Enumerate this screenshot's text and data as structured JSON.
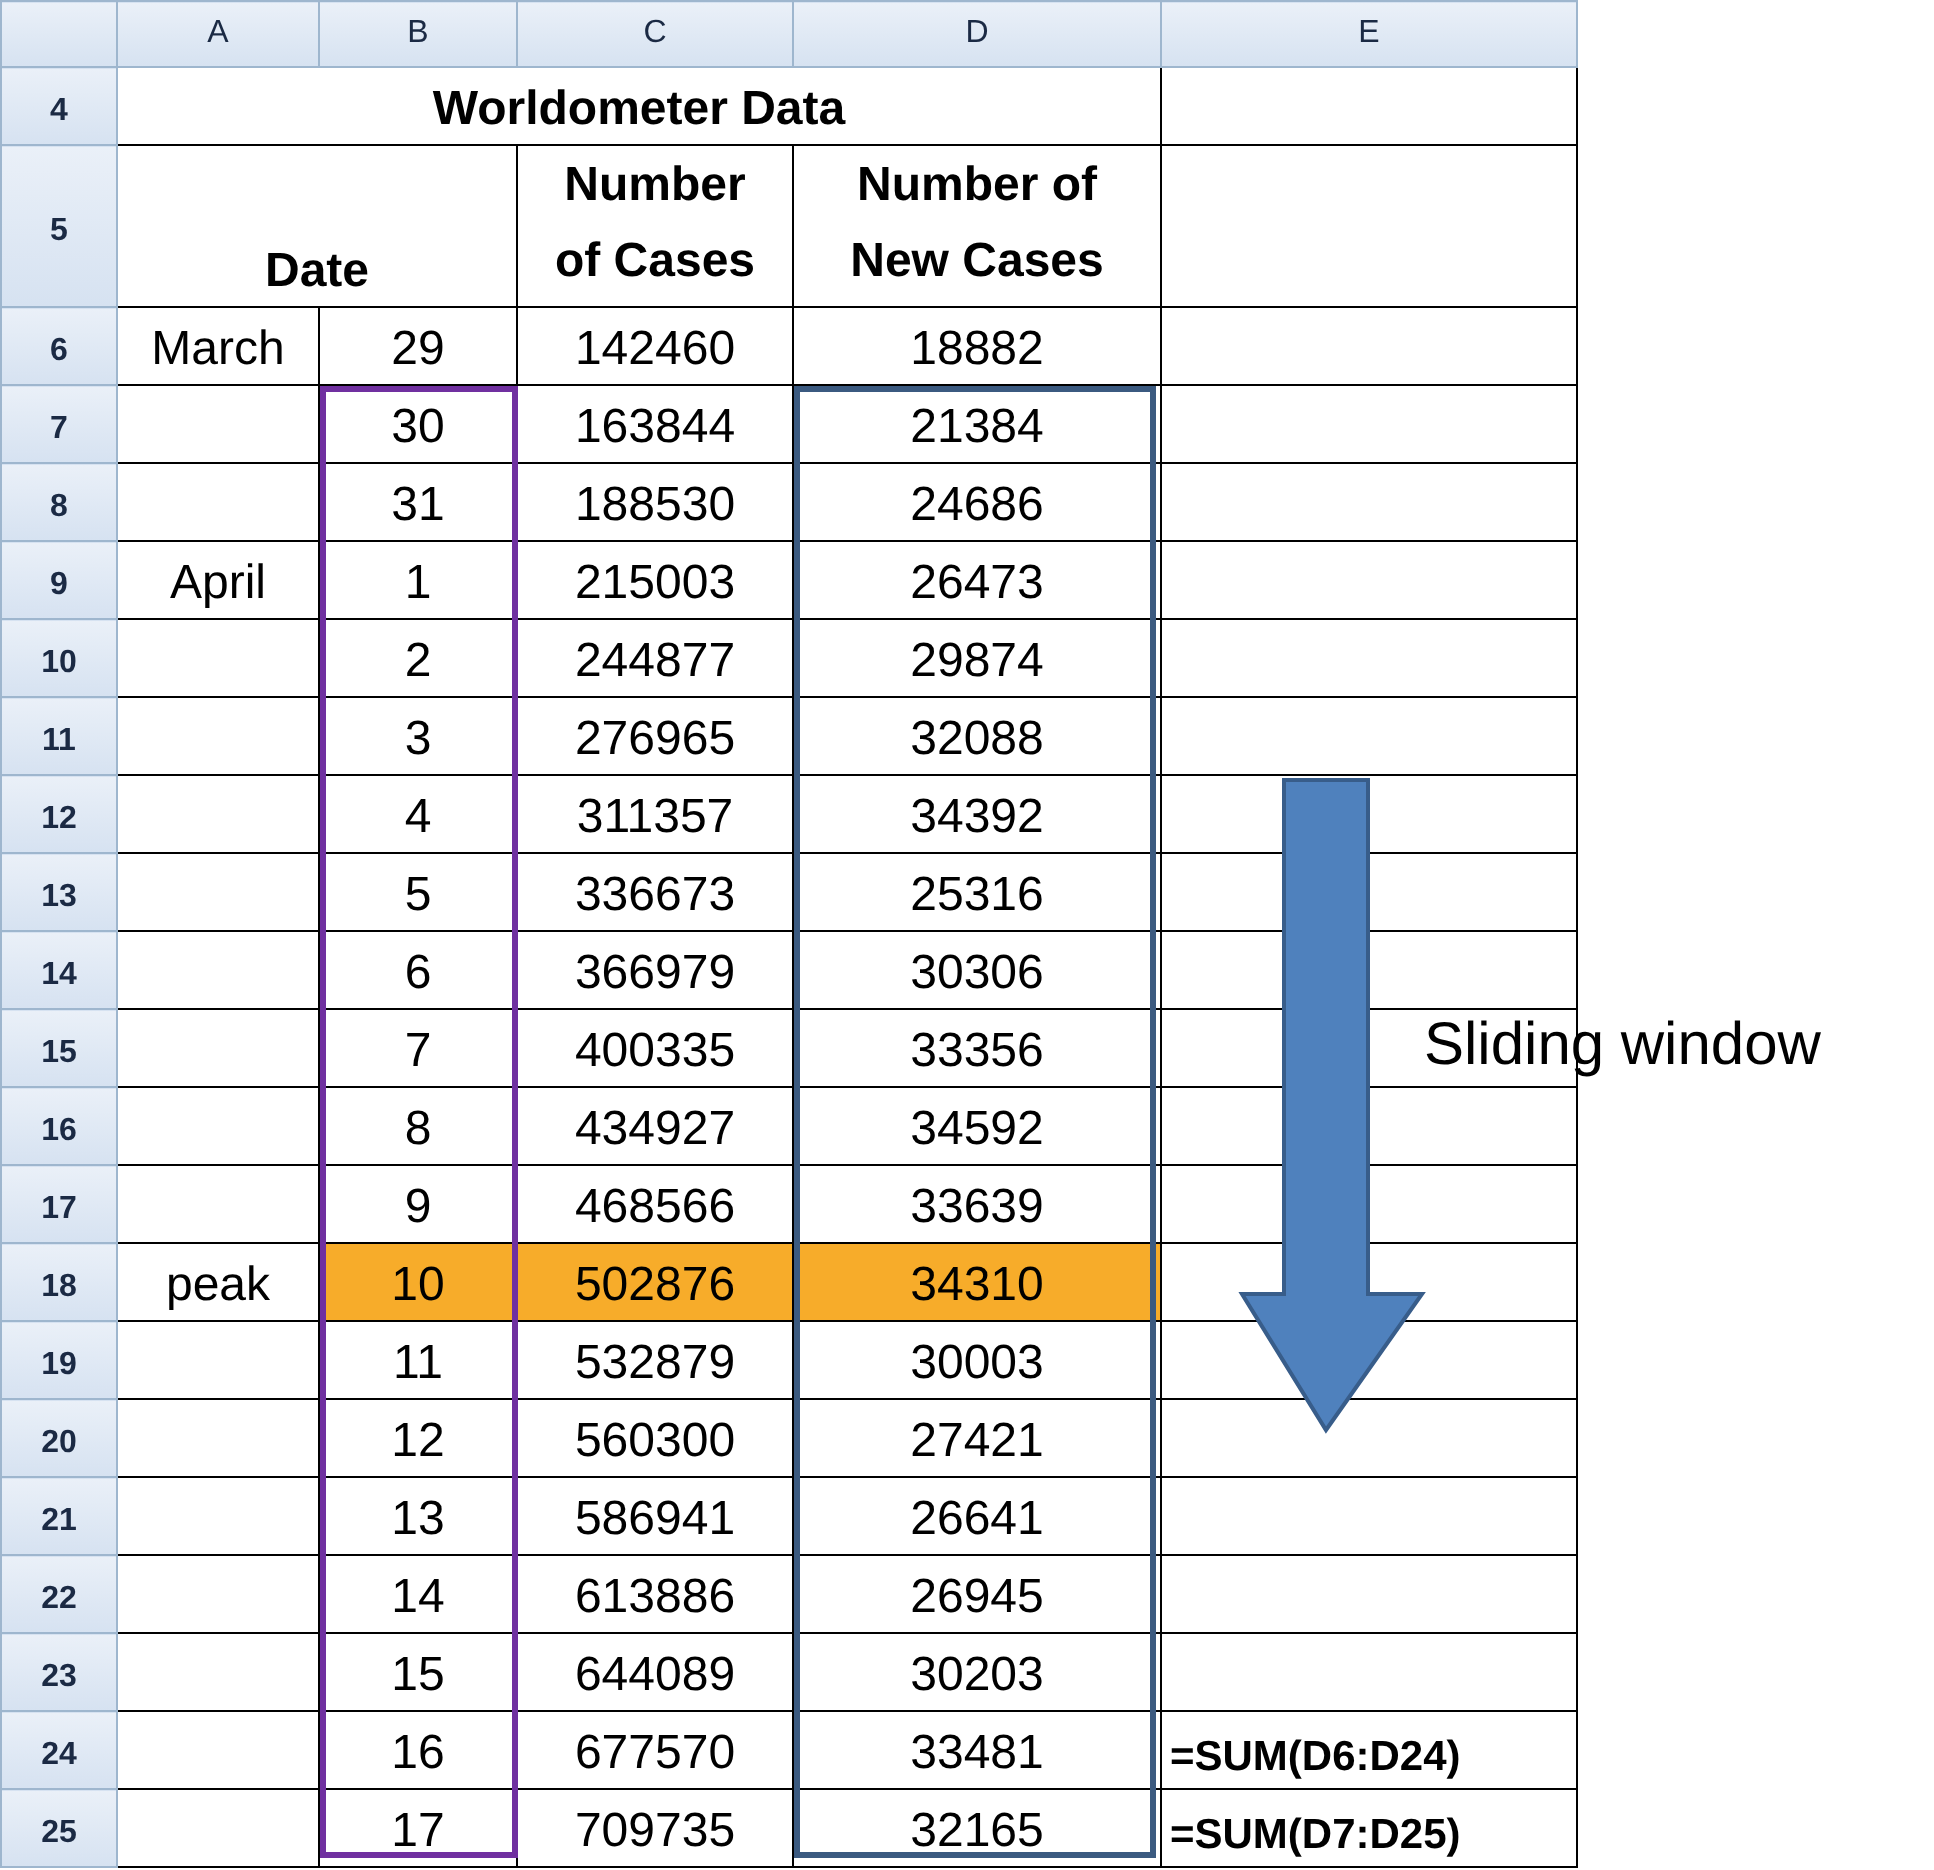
{
  "columns": [
    "A",
    "B",
    "C",
    "D",
    "E"
  ],
  "title_row": {
    "row": "4",
    "text": "Worldometer Data"
  },
  "header_row": {
    "row": "5",
    "date": "Date",
    "cases": [
      "Number",
      "of Cases"
    ],
    "new_cases": [
      "Number of",
      "New Cases"
    ]
  },
  "rows": [
    {
      "row": "6",
      "month": "March",
      "day": "29",
      "cases": "142460",
      "new_cases": "18882",
      "highlighted": false
    },
    {
      "row": "7",
      "day": "30",
      "cases": "163844",
      "new_cases": "21384",
      "highlighted": false
    },
    {
      "row": "8",
      "day": "31",
      "cases": "188530",
      "new_cases": "24686",
      "highlighted": false
    },
    {
      "row": "9",
      "month": "April",
      "day": "1",
      "cases": "215003",
      "new_cases": "26473",
      "highlighted": false
    },
    {
      "row": "10",
      "day": "2",
      "cases": "244877",
      "new_cases": "29874",
      "highlighted": false
    },
    {
      "row": "11",
      "day": "3",
      "cases": "276965",
      "new_cases": "32088",
      "highlighted": false
    },
    {
      "row": "12",
      "day": "4",
      "cases": "311357",
      "new_cases": "34392",
      "highlighted": false
    },
    {
      "row": "13",
      "day": "5",
      "cases": "336673",
      "new_cases": "25316",
      "highlighted": false
    },
    {
      "row": "14",
      "day": "6",
      "cases": "366979",
      "new_cases": "30306",
      "highlighted": false
    },
    {
      "row": "15",
      "day": "7",
      "cases": "400335",
      "new_cases": "33356",
      "highlighted": false
    },
    {
      "row": "16",
      "day": "8",
      "cases": "434927",
      "new_cases": "34592",
      "highlighted": false
    },
    {
      "row": "17",
      "day": "9",
      "cases": "468566",
      "new_cases": "33639",
      "highlighted": false
    },
    {
      "row": "18",
      "month": "peak",
      "day": "10",
      "cases": "502876",
      "new_cases": "34310",
      "highlighted": true
    },
    {
      "row": "19",
      "day": "11",
      "cases": "532879",
      "new_cases": "30003",
      "highlighted": false
    },
    {
      "row": "20",
      "day": "12",
      "cases": "560300",
      "new_cases": "27421",
      "highlighted": false
    },
    {
      "row": "21",
      "day": "13",
      "cases": "586941",
      "new_cases": "26641",
      "highlighted": false
    },
    {
      "row": "22",
      "day": "14",
      "cases": "613886",
      "new_cases": "26945",
      "highlighted": false
    },
    {
      "row": "23",
      "day": "15",
      "cases": "644089",
      "new_cases": "30203",
      "highlighted": false
    },
    {
      "row": "24",
      "day": "16",
      "cases": "677570",
      "new_cases": "33481",
      "formula": "=SUM(D6:D24)",
      "highlighted": false
    },
    {
      "row": "25",
      "day": "17",
      "cases": "709735",
      "new_cases": "32165",
      "formula": "=SUM(D7:D25)",
      "highlighted": false
    }
  ],
  "annotation": {
    "text": "Sliding window"
  }
}
